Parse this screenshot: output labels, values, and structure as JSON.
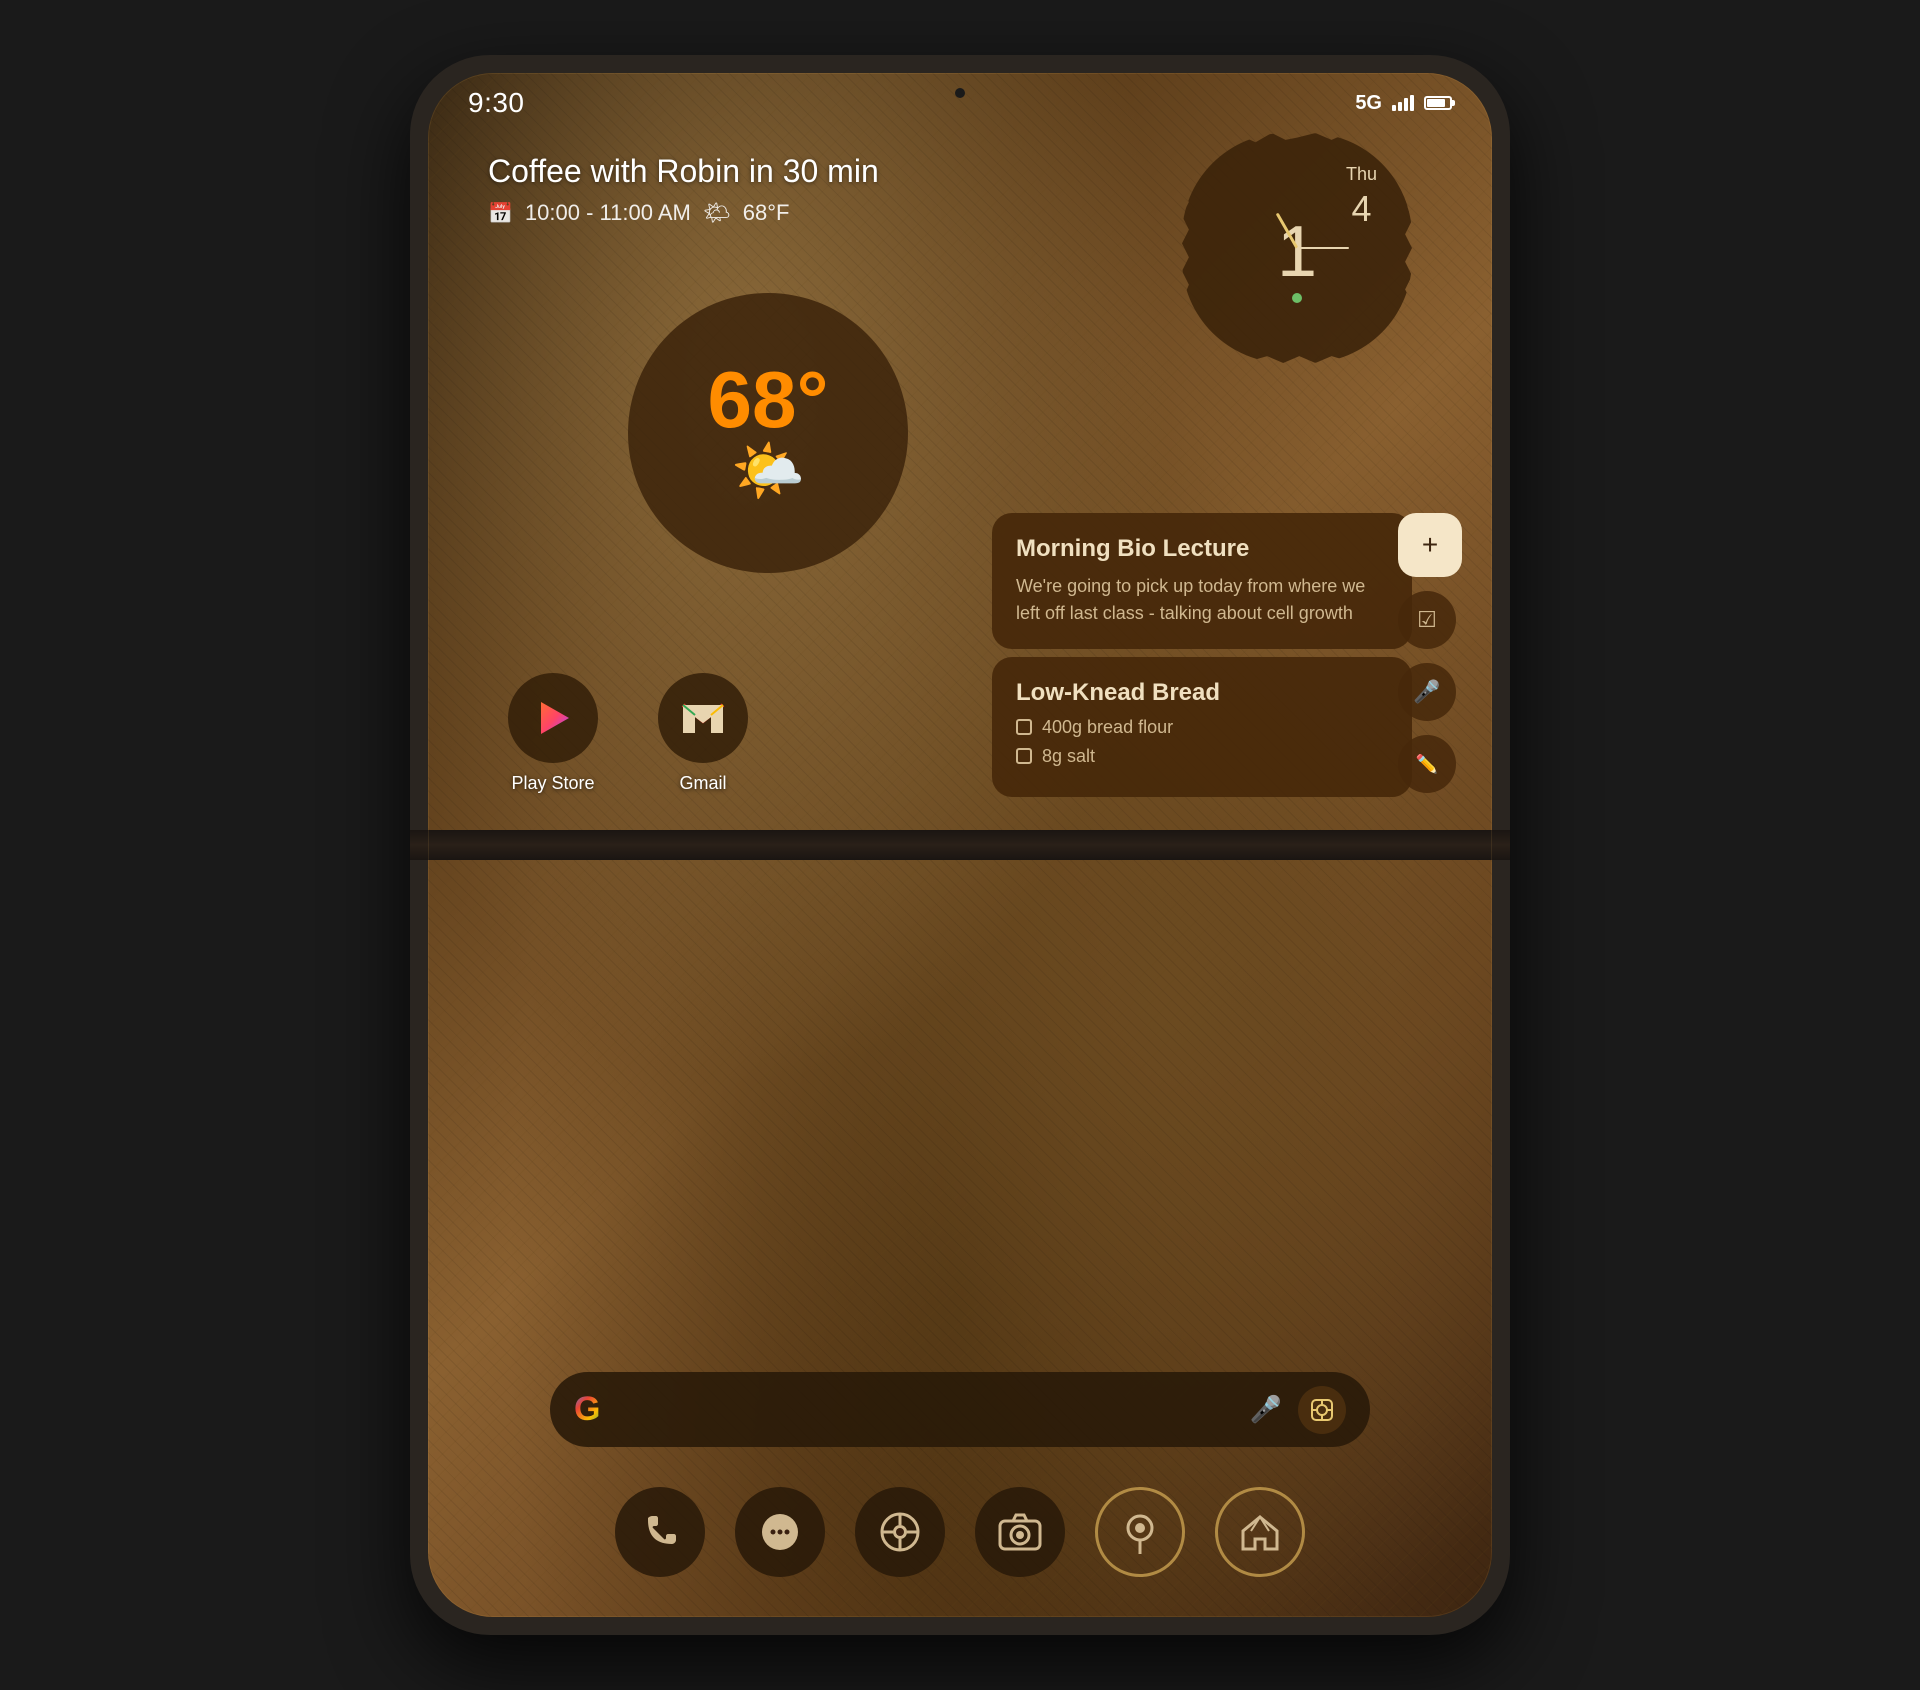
{
  "status": {
    "time": "9:30",
    "network": "5G",
    "battery_level": "80"
  },
  "calendar_widget": {
    "title": "Coffee with Robin in 30 min",
    "time_range": "10:00 - 11:00 AM",
    "weather": "68°F"
  },
  "weather_widget": {
    "temperature": "68°"
  },
  "clock_widget": {
    "day": "Thu",
    "date": "4"
  },
  "notes": {
    "note1": {
      "title": "Morning Bio Lecture",
      "body": "We're going to pick up today from where we left off last class - talking about cell growth"
    },
    "note2": {
      "title": "Low-Knead Bread",
      "items": [
        "400g bread flour",
        "8g salt"
      ]
    }
  },
  "side_actions": {
    "add": "+",
    "check": "☑",
    "mic": "🎤",
    "edit": "✏"
  },
  "apps": {
    "play_store": {
      "label": "Play Store",
      "icon": "▶"
    },
    "gmail": {
      "label": "Gmail",
      "icon": "M"
    }
  },
  "search": {
    "g_logo": "G",
    "mic_icon": "🎤",
    "lens_icon": "📷"
  },
  "dock": {
    "phone": "📞",
    "messages": "💬",
    "chrome": "⊙",
    "camera": "📷",
    "maps": "📍",
    "home": "⌂"
  }
}
